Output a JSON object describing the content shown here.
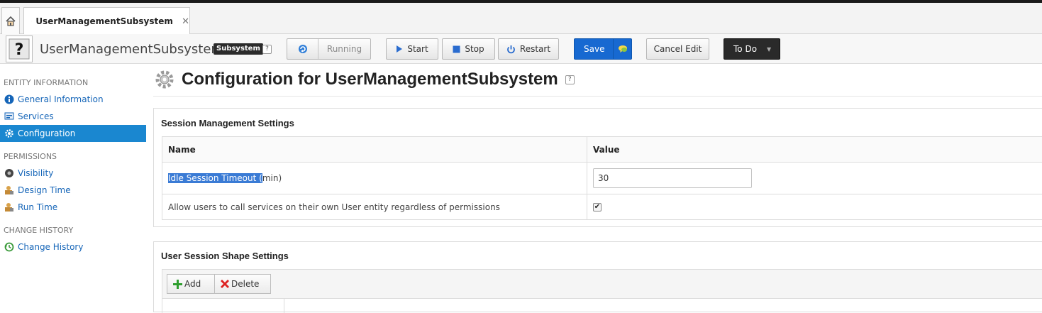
{
  "tabs": {
    "home_icon": "home-icon",
    "document_tab_label": "UserManagementSubsystem"
  },
  "toolbar": {
    "entity_name": "UserManagementSubsystem",
    "entity_type_badge": "Subsystem",
    "help": "?",
    "running_label": "Running",
    "start_label": "Start",
    "stop_label": "Stop",
    "restart_label": "Restart",
    "save_label": "Save",
    "cancel_edit_label": "Cancel Edit",
    "todo_label": "To Do"
  },
  "sidebar": {
    "sections": [
      {
        "heading": "ENTITY INFORMATION",
        "items": [
          {
            "label": "General Information",
            "icon": "info-icon"
          },
          {
            "label": "Services",
            "icon": "services-icon"
          },
          {
            "label": "Configuration",
            "icon": "gear-icon",
            "active": true
          }
        ]
      },
      {
        "heading": "PERMISSIONS",
        "items": [
          {
            "label": "Visibility",
            "icon": "eye-icon"
          },
          {
            "label": "Design Time",
            "icon": "user-lock-icon"
          },
          {
            "label": "Run Time",
            "icon": "user-lock-icon"
          }
        ]
      },
      {
        "heading": "CHANGE HISTORY",
        "items": [
          {
            "label": "Change History",
            "icon": "history-icon"
          }
        ]
      }
    ]
  },
  "main": {
    "title": "Configuration for UserManagementSubsystem",
    "help": "?",
    "session_panel": {
      "title": "Session Management Settings",
      "columns": [
        "Name",
        "Value"
      ],
      "rows": [
        {
          "name_selected": "Idle Session Timeout (",
          "name_rest": "min)",
          "value": "30"
        },
        {
          "name": "Allow users to call services on their own User entity regardless of permissions",
          "checked": true
        }
      ]
    },
    "shape_panel": {
      "title": "User Session Shape Settings",
      "add_label": "Add",
      "delete_label": "Delete"
    }
  },
  "colors": {
    "accent": "#1a87d0",
    "save": "#1769d1",
    "todo": "#2a2a2a",
    "link": "#1565b8"
  }
}
